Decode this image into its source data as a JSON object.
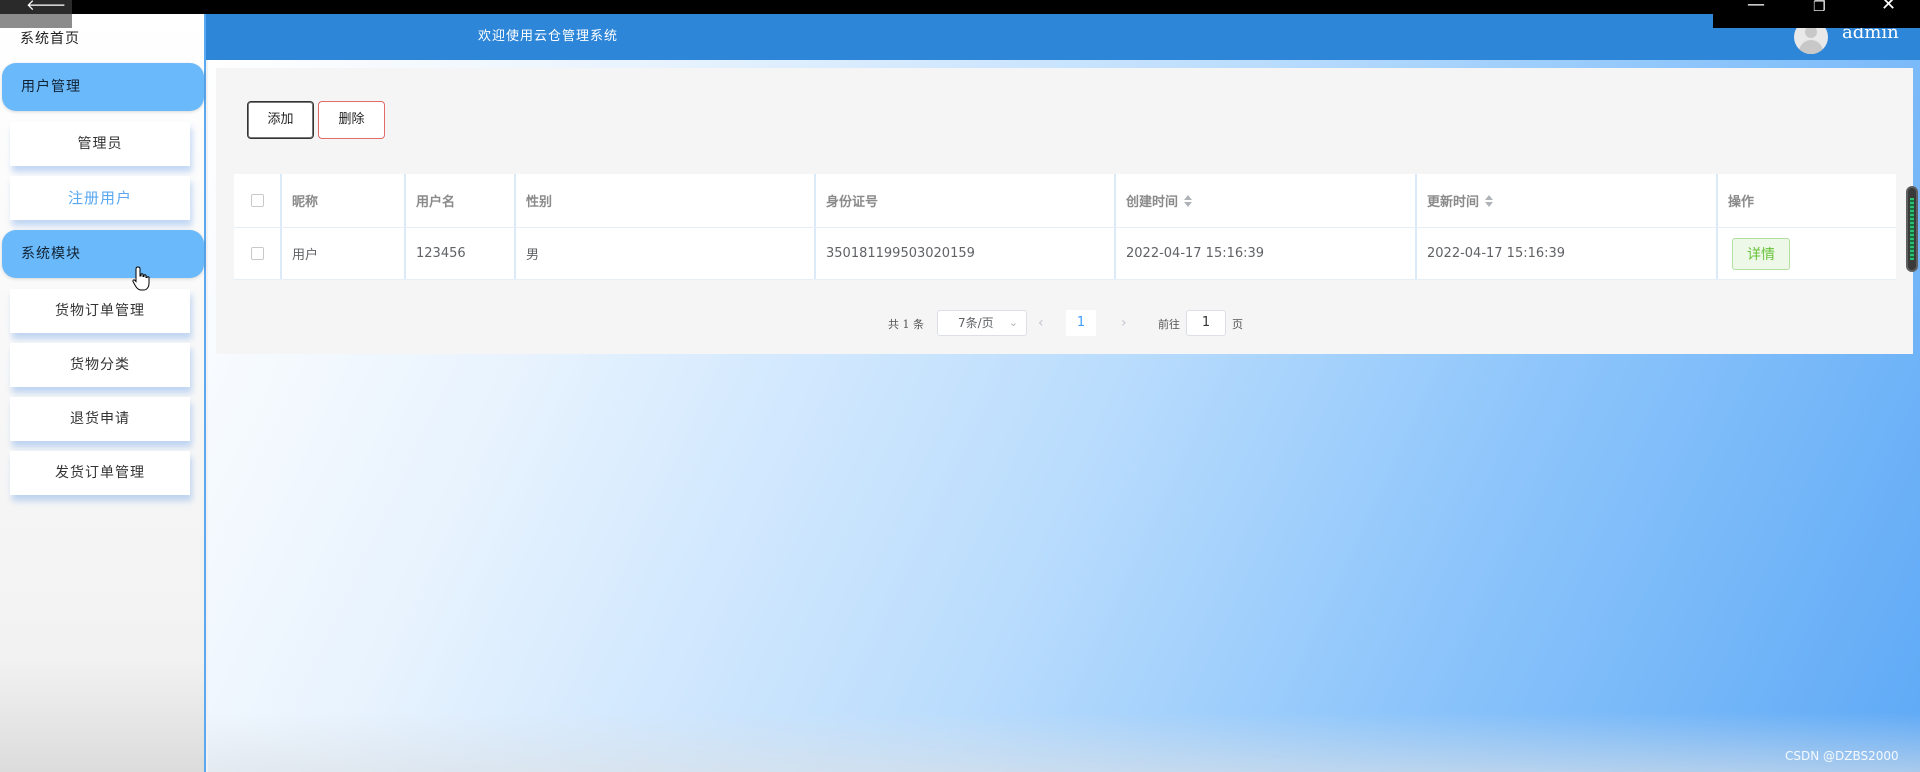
{
  "window": {
    "back_glyph": "🡐",
    "min_glyph": "—",
    "max_glyph": "❐",
    "close_glyph": "✕"
  },
  "sidebar": {
    "home": "系统首页",
    "groups": [
      {
        "label": "用户管理",
        "items": [
          "管理员",
          "注册用户"
        ]
      },
      {
        "label": "系统模块",
        "items": [
          "货物订单管理",
          "货物分类",
          "退货申请",
          "发货订单管理"
        ]
      }
    ]
  },
  "header": {
    "title": "欢迎使用云仓管理系统",
    "user": "admin"
  },
  "toolbar": {
    "add_label": "添加",
    "delete_label": "删除"
  },
  "table": {
    "columns": [
      "昵称",
      "用户名",
      "性别",
      "身份证号",
      "创建时间",
      "更新时间",
      "操作"
    ],
    "rows": [
      {
        "nickname": "用户",
        "username": "123456",
        "gender": "男",
        "id_number": "350181199503020159",
        "created": "2022-04-17 15:16:39",
        "updated": "2022-04-17 15:16:39",
        "action": "详情"
      }
    ]
  },
  "pagination": {
    "total": "共 1 条",
    "page_size": "7条/页",
    "current": "1",
    "goto_label": "前往",
    "goto_value": "1",
    "page_suffix": "页",
    "prev_glyph": "‹",
    "next_glyph": "›",
    "chevron_glyph": "⌄"
  },
  "watermark": "CSDN @DZBS2000",
  "colors": {
    "header": "#2e86d8",
    "sidebar_group": "#6ab9fb",
    "active_item": "#5aa8f0",
    "detail_button": "#67c23a",
    "delete_border": "#e46a6a"
  }
}
